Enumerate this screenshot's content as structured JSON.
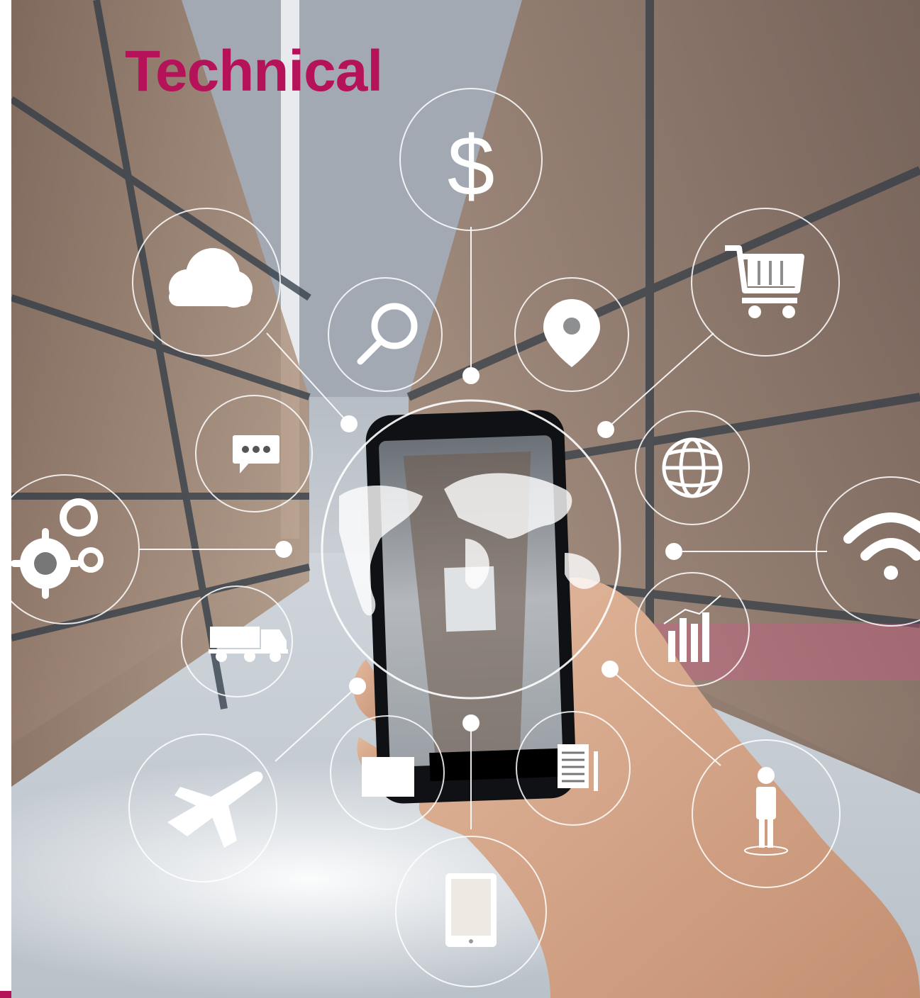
{
  "title": "Technical",
  "colors": {
    "accent": "#b5125a",
    "overlay": "#ffffff"
  },
  "icons": [
    "dollar-icon",
    "cloud-icon",
    "search-icon",
    "location-pin-icon",
    "shopping-cart-icon",
    "chat-bubble-icon",
    "globe-icon",
    "gears-icon",
    "wifi-icon",
    "truck-icon",
    "bar-chart-icon",
    "airplane-icon",
    "envelope-icon",
    "document-icon",
    "person-icon",
    "tablet-icon"
  ]
}
